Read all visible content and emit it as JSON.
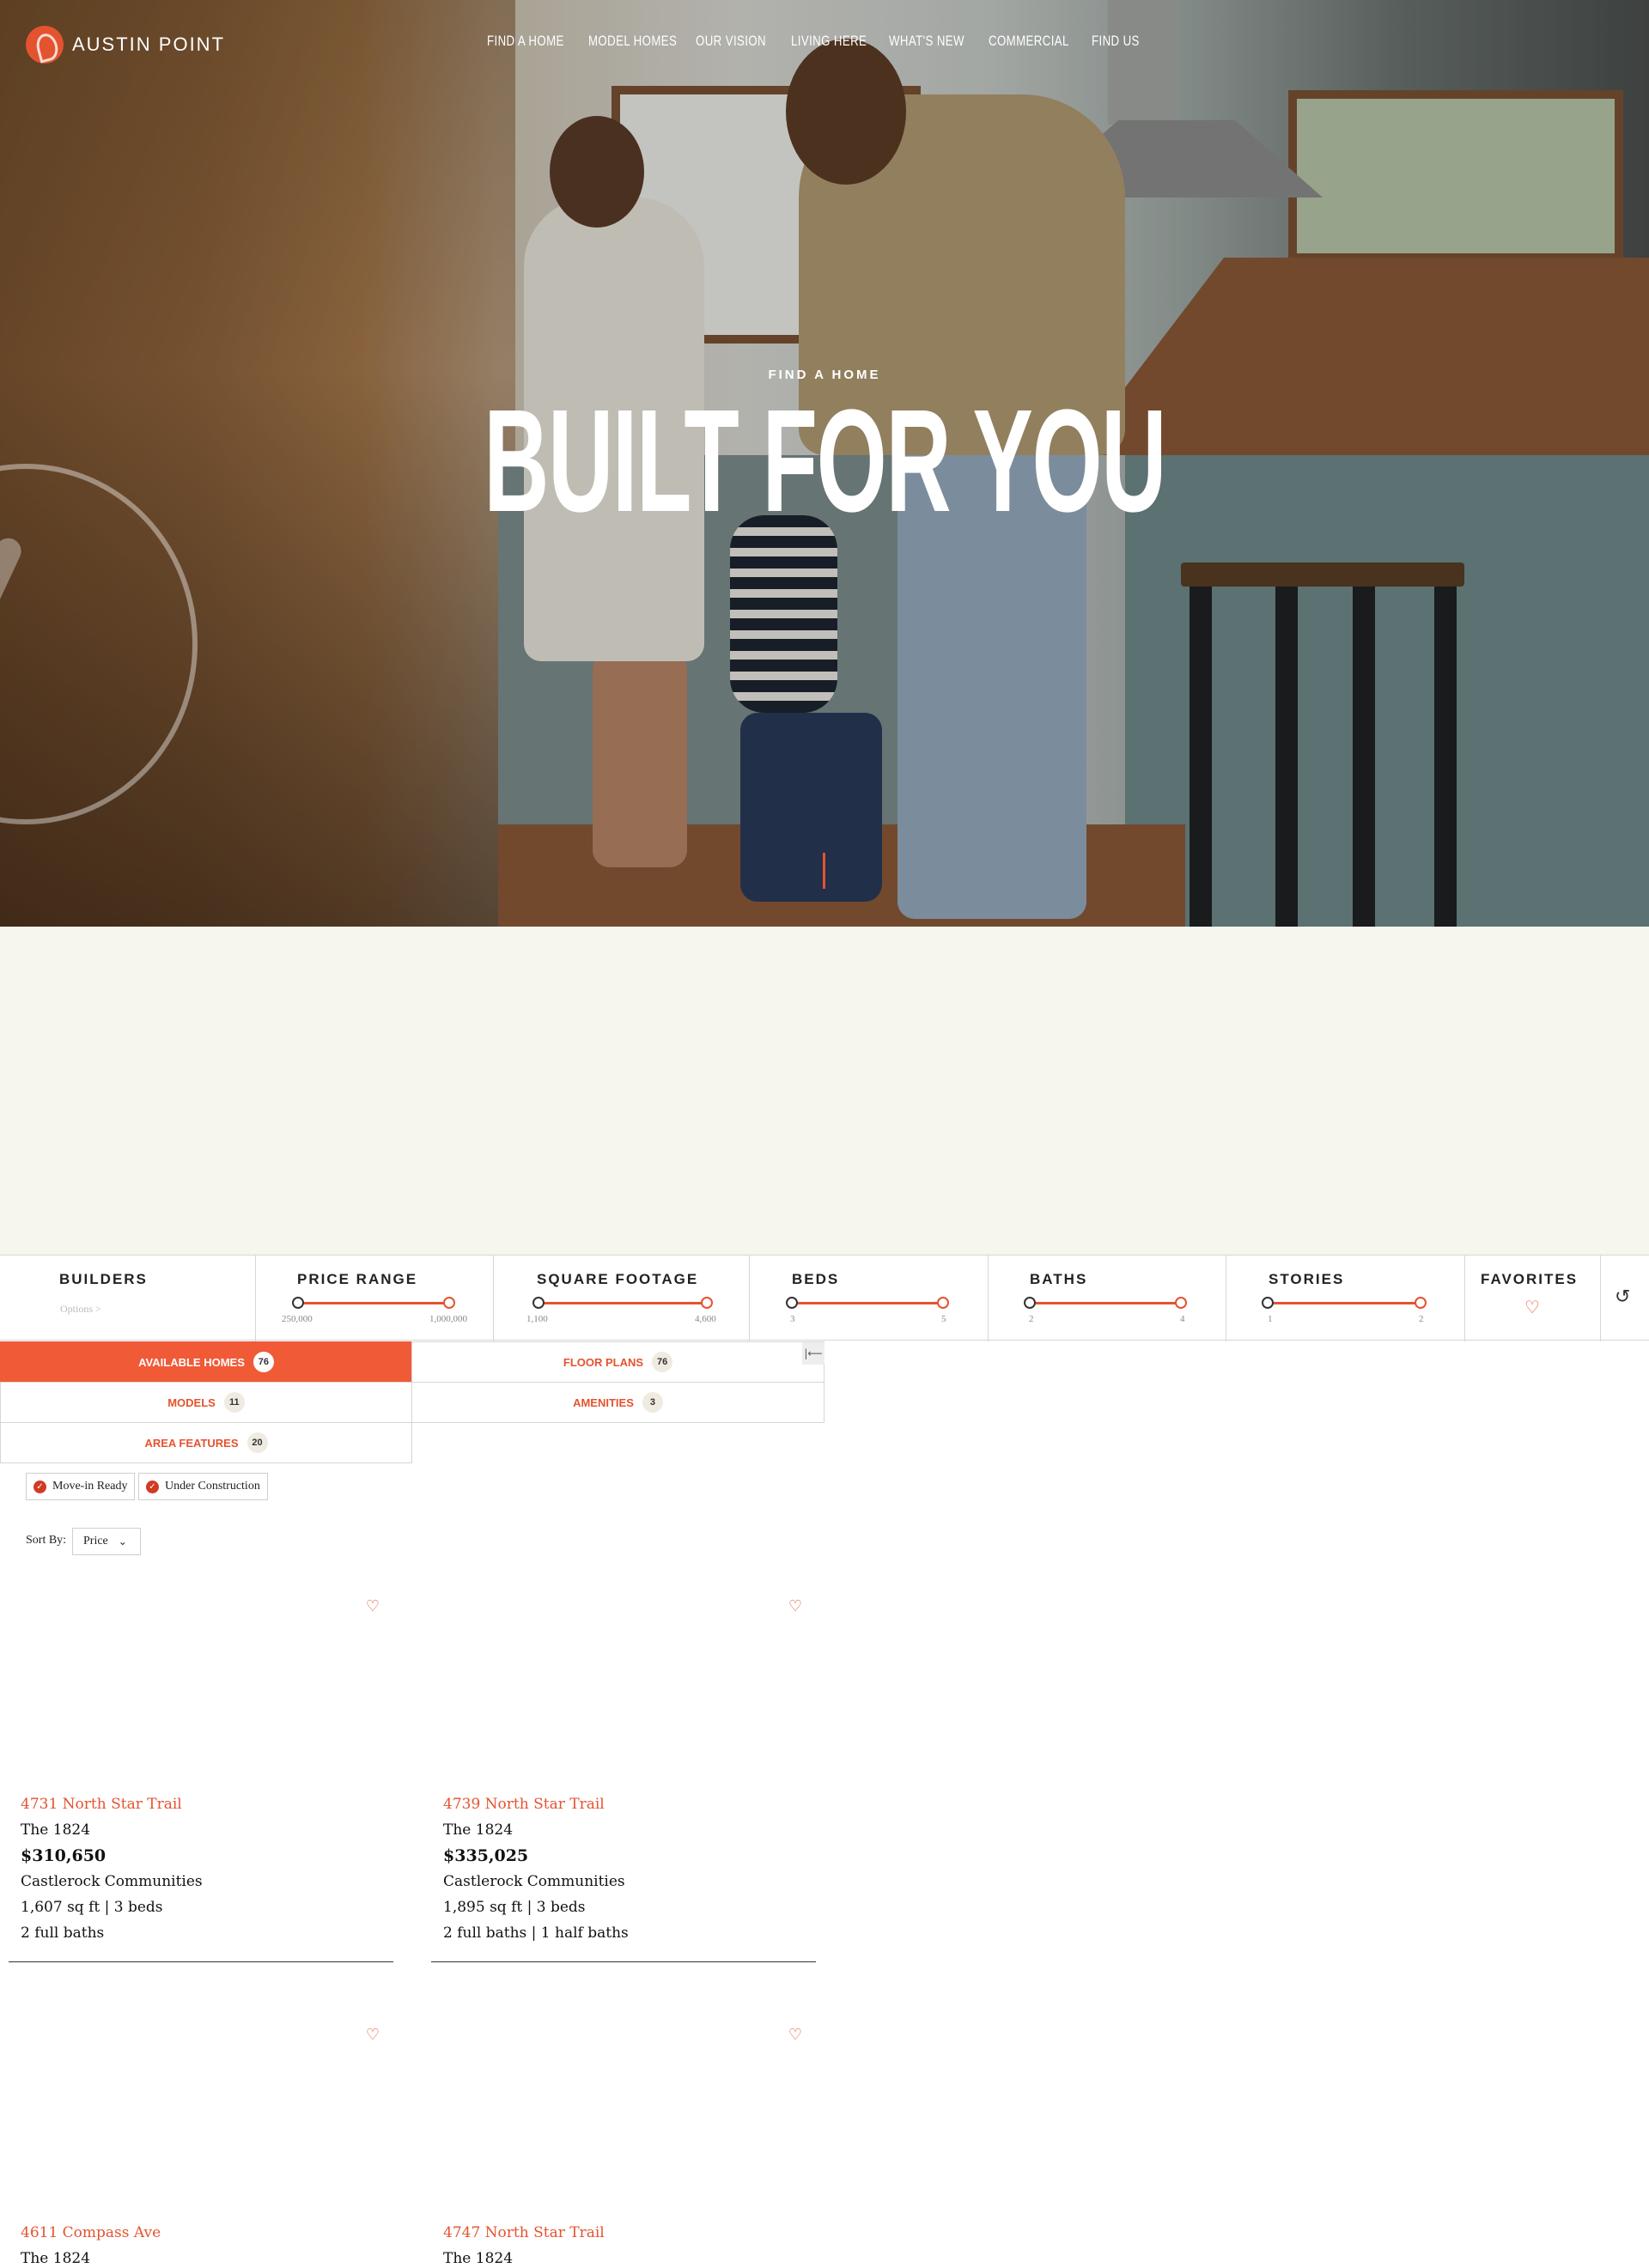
{
  "brand": {
    "name": "AUSTIN POINT",
    "accent": "#e4532f"
  },
  "nav": {
    "items": [
      "FIND A HOME",
      "MODEL HOMES",
      "OUR VISION",
      "LIVING HERE",
      "WHAT'S NEW",
      "COMMERCIAL",
      "FIND US"
    ]
  },
  "hero": {
    "eyebrow": "FIND A HOME",
    "title": "BUILT FOR YOU"
  },
  "filters": {
    "builders": {
      "label": "BUILDERS",
      "options_label": "Options >"
    },
    "price": {
      "label": "PRICE RANGE",
      "min": "250,000",
      "max": "1,000,000"
    },
    "sqft": {
      "label": "SQUARE FOOTAGE",
      "min": "1,100",
      "max": "4,600"
    },
    "beds": {
      "label": "BEDS",
      "min": "3",
      "max": "5"
    },
    "baths": {
      "label": "BATHS",
      "min": "2",
      "max": "4"
    },
    "stories": {
      "label": "STORIES",
      "min": "1",
      "max": "2"
    },
    "favorites": {
      "label": "FAVORITES"
    },
    "reset_icon": "reset-icon"
  },
  "tabs": [
    {
      "label": "AVAILABLE HOMES",
      "count": "76",
      "active": true
    },
    {
      "label": "FLOOR PLANS",
      "count": "76"
    },
    {
      "label": "MODELS",
      "count": "11"
    },
    {
      "label": "AMENITIES",
      "count": "3"
    },
    {
      "label": "AREA FEATURES",
      "count": "20"
    }
  ],
  "chips": [
    {
      "label": "Move-in Ready"
    },
    {
      "label": "Under Construction"
    }
  ],
  "sort": {
    "label": "Sort By:",
    "value": "Price"
  },
  "homes": [
    {
      "address": "4731 North Star Trail",
      "plan": "The 1824",
      "price": "$310,650",
      "builder": "Castlerock Communities",
      "size": "1,607 sq ft | 3 beds",
      "baths": "2 full baths"
    },
    {
      "address": "4739 North Star Trail",
      "plan": "The 1824",
      "price": "$335,025",
      "builder": "Castlerock Communities",
      "size": "1,895 sq ft | 3 beds",
      "baths": "2 full baths | 1 half baths"
    },
    {
      "address": "4611 Compass Ave",
      "plan": "The 1824"
    },
    {
      "address": "4747 North Star Trail",
      "plan": "The 1824"
    }
  ]
}
